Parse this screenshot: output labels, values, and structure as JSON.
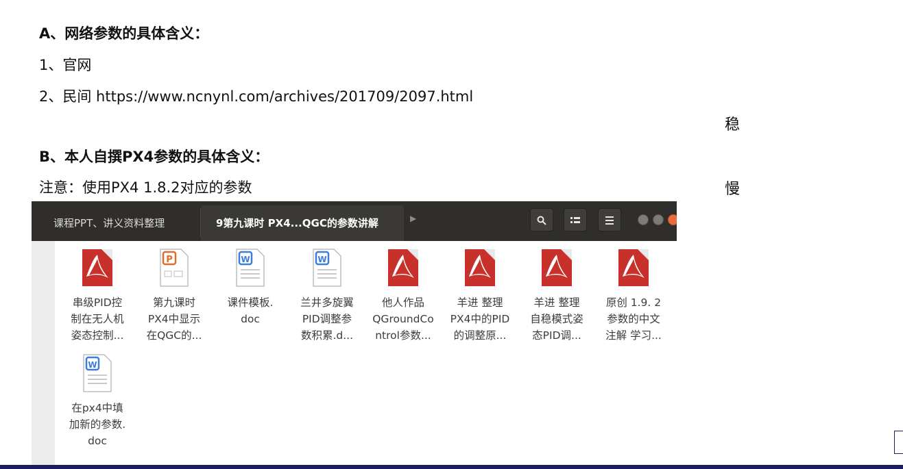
{
  "document": {
    "heading_a": "A、网络参数的具体含义：",
    "item_1": "1、官网",
    "item_2": "2、民间  https://www.ncnynl.com/archives/201709/2097.html",
    "side_char_1": "稳",
    "heading_b": "B、本人自撰PX4参数的具体含义：",
    "note": "注意：使用PX4 1.8.2对应的参数",
    "side_char_2": "慢"
  },
  "window": {
    "tabs": [
      {
        "label": "课程PPT、讲义资料整理"
      },
      {
        "label": "9第九课时  PX4...QGC的参数讲解"
      }
    ],
    "toolbar": {
      "search_icon": "search-icon",
      "view_icon": "list-view-icon",
      "menu_icon": "hamburger-menu-icon"
    }
  },
  "files": [
    {
      "type": "pdf",
      "name": "串级PID控\n制在无人机\n姿态控制..."
    },
    {
      "type": "ppt",
      "name": "第九课时\nPX4中显示\n在QGC的..."
    },
    {
      "type": "doc",
      "name": "课件模板.\ndoc"
    },
    {
      "type": "doc",
      "name": "兰井多旋翼\nPID调整参\n数积累.d..."
    },
    {
      "type": "pdf",
      "name": "他人作品\nQGroundCo\nntrol参数..."
    },
    {
      "type": "pdf",
      "name": "羊进  整理\nPX4中的PID\n的调整原..."
    },
    {
      "type": "pdf",
      "name": "羊进  整理\n自稳模式姿\n态PID调..."
    },
    {
      "type": "pdf",
      "name": "原创  1.9. 2\n参数的中文\n注解  学习..."
    },
    {
      "type": "doc",
      "name": "在px4中填\n加新的参数.\ndoc"
    }
  ],
  "colors": {
    "titlebar": "#2f2e2a",
    "pdf_red": "#c8312b",
    "ppt_orange": "#e46a2b",
    "doc_blue": "#3d7ed8",
    "bottom_bar": "#1c1d5e"
  }
}
